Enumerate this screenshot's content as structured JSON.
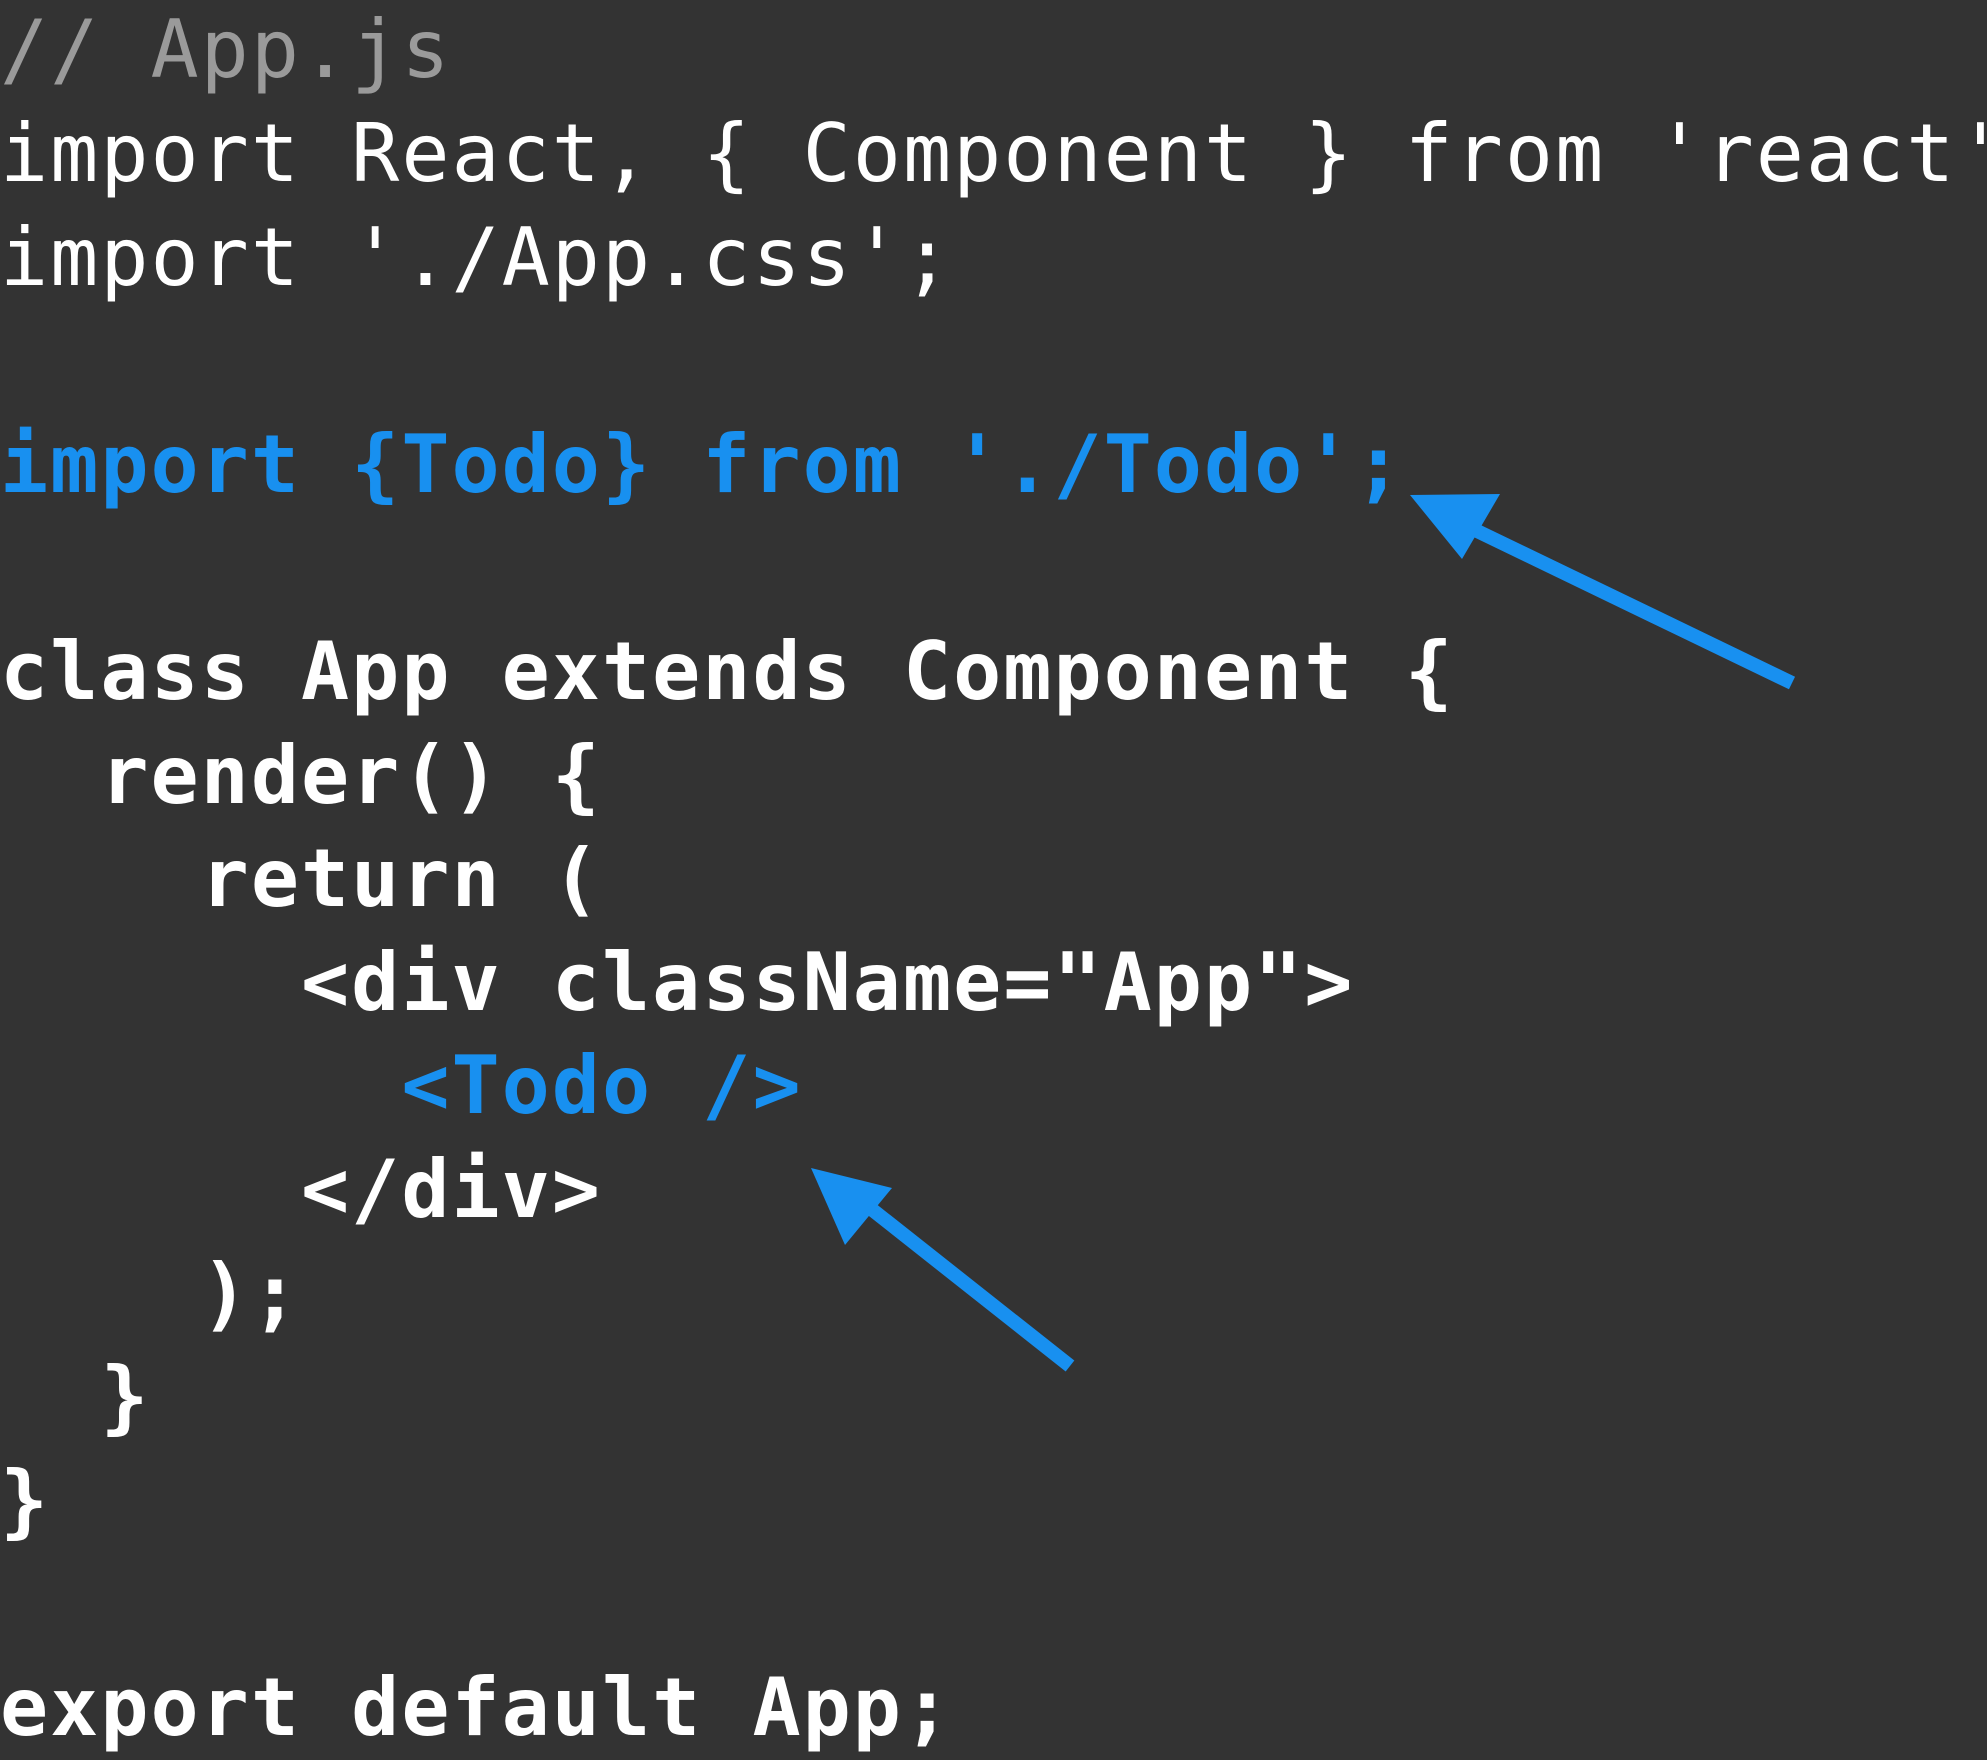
{
  "editor": {
    "lines": {
      "comment": "// App.js",
      "import_react": "import React, { Component } from 'react';",
      "import_css": "import './App.css';",
      "import_todo": "import {Todo} from './Todo';",
      "class_decl": "class App extends Component {",
      "render_decl": "  render() {",
      "return_open": "    return (",
      "div_open": "      <div className=\"App\">",
      "todo_element": "        <Todo />",
      "div_close": "      </div>",
      "return_close": "    );",
      "render_close": "  }",
      "class_close": "}",
      "export": "export default App;"
    }
  },
  "colors": {
    "background": "#333333",
    "text": "#ffffff",
    "comment": "#9a9a9a",
    "highlight": "#1890f0",
    "arrow": "#1890f0"
  },
  "annotations": {
    "arrows": [
      {
        "target": "import-todo-line",
        "icon": "arrow-icon"
      },
      {
        "target": "todo-element-line",
        "icon": "arrow-icon"
      }
    ]
  }
}
